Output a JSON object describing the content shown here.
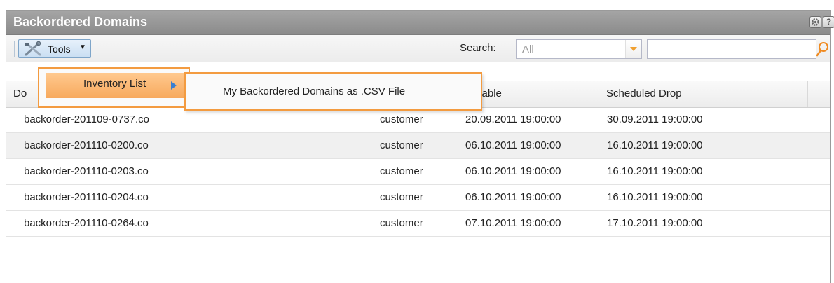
{
  "panel": {
    "title": "Backordered Domains",
    "icons": [
      "gear-icon",
      "help-icon"
    ],
    "help_glyph": "?"
  },
  "toolbar": {
    "tools_label": "Tools",
    "tools_caret": "▼",
    "search_label": "Search:",
    "search_scope_value": "All",
    "search_value": ""
  },
  "menu": {
    "inventory_list_label": "Inventory List",
    "csv_export_label": "My Backordered Domains as .CSV File"
  },
  "grid": {
    "columns": [
      "Do",
      "vailable",
      "Scheduled Drop"
    ],
    "rows": [
      {
        "domain": "backorder-201109-0737.co",
        "owner": "customer",
        "available": "20.09.2011 19:00:00",
        "scheduled_drop": "30.09.2011 19:00:00"
      },
      {
        "domain": "backorder-201110-0200.co",
        "owner": "customer",
        "available": "06.10.2011 19:00:00",
        "scheduled_drop": "16.10.2011 19:00:00"
      },
      {
        "domain": "backorder-201110-0203.co",
        "owner": "customer",
        "available": "06.10.2011 19:00:00",
        "scheduled_drop": "16.10.2011 19:00:00"
      },
      {
        "domain": "backorder-201110-0204.co",
        "owner": "customer",
        "available": "06.10.2011 19:00:00",
        "scheduled_drop": "16.10.2011 19:00:00"
      },
      {
        "domain": "backorder-201110-0264.co",
        "owner": "customer",
        "available": "07.10.2011 19:00:00",
        "scheduled_drop": "17.10.2011 19:00:00"
      }
    ]
  },
  "colors": {
    "titlebar": "#979797",
    "menu_border": "#f39b40",
    "menu_highlight": "#f7a95d",
    "submenu_arrow": "#3a7fd0",
    "dropdown_arrow": "#f0a030"
  }
}
